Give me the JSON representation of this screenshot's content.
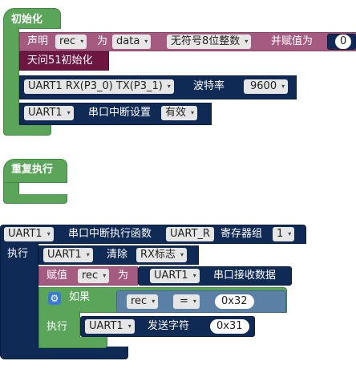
{
  "init": {
    "hat_label": "初始化",
    "declare": {
      "label": "声明",
      "var": "rec",
      "as": "为",
      "scope": "data",
      "type": "无符号8位整数",
      "assign": "并赋值为",
      "value": "0"
    },
    "tianwen": "天问51初始化",
    "uart_config": {
      "port": "UART1 RX(P3_0) TX(P3_1)",
      "baud_label": "波特率",
      "baud": "9600"
    },
    "interrupt": {
      "port": "UART1",
      "label": "串口中断设置",
      "state": "有效"
    }
  },
  "loop": {
    "hat_label": "重复执行"
  },
  "isr": {
    "port": "UART1",
    "label": "串口中断执行函数",
    "reg": "UART_R",
    "reggroup_label": "寄存器组",
    "reggroup": "1",
    "exec_label": "执行",
    "clear": {
      "port": "UART1",
      "label": "清除",
      "flag": "RX标志"
    },
    "assign": {
      "label": "赋值",
      "var": "rec",
      "as": "为",
      "port": "UART1",
      "recv": "串口接收数据"
    },
    "if": {
      "label": "如果",
      "var": "rec",
      "op": "=",
      "value": "0x32",
      "exec_label": "执行",
      "send": {
        "port": "UART1",
        "label": "发送字符",
        "value": "0x31"
      }
    }
  },
  "colors": {
    "green": "#5ba55b",
    "purple": "#a55b80",
    "darkred": "#6d1641",
    "navy": "#0f2a55"
  }
}
